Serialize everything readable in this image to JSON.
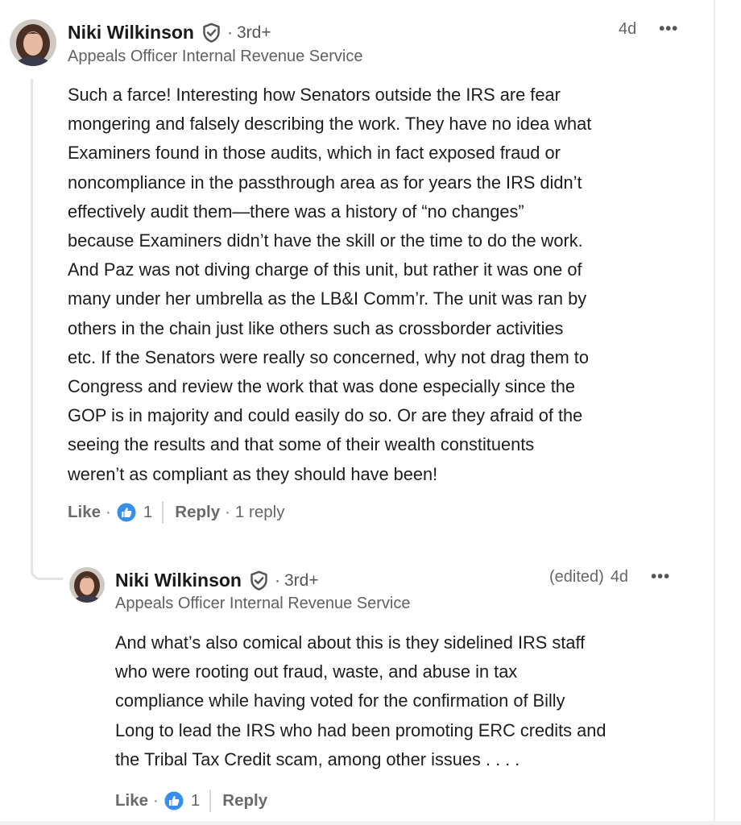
{
  "comment": {
    "author": "Niki Wilkinson",
    "degree": "3rd+",
    "headline": "Appeals Officer Internal Revenue Service",
    "time": "4d",
    "text": "Such a farce! Interesting how Senators outside the IRS are fear\nmongering and falsely describing the work. They have no idea what\nExaminers found in those audits, which in fact exposed fraud or\nnoncompliance in the passthrough area as for years the IRS didn’t\neffectively audit them—there was a history of “no changes”\nbecause Examiners didn’t have the skill or the time to do the work.\nAnd Paz was not diving charge of this unit, but rather it was one of\nmany under her umbrella as the LB&I Comm’r. The unit was ran by\nothers in the chain just like others such as crossborder activities\netc. If the Senators were really so concerned, why not drag them to\nCongress and review the work that was done especially since the\nGOP is in majority and could easily do so. Or are they afraid of the\nseeing the results and that some of their wealth constituents\nweren’t as compliant as they should have been!",
    "like_label": "Like",
    "like_count": "1",
    "reply_label": "Reply",
    "reply_count": "1 reply"
  },
  "reply": {
    "author": "Niki Wilkinson",
    "degree": "3rd+",
    "headline": "Appeals Officer Internal Revenue Service",
    "edited": "(edited)",
    "time": "4d",
    "text": "And what’s also comical about this is they sidelined IRS staff\nwho were rooting out fraud, waste, and abuse in tax\ncompliance while having voted for the confirmation of Billy\nLong to lead the IRS who had been promoting ERC credits and\nthe Tribal Tax Credit scam, among other issues . . . .",
    "like_label": "Like",
    "like_count": "1",
    "reply_label": "Reply"
  },
  "icons": {
    "verified": "shield-check-icon",
    "more": "more-options-icon",
    "reaction": "thumbs-up-reaction-icon"
  },
  "colors": {
    "reaction_blue": "#378fe9",
    "verified_gray": "#555555"
  }
}
